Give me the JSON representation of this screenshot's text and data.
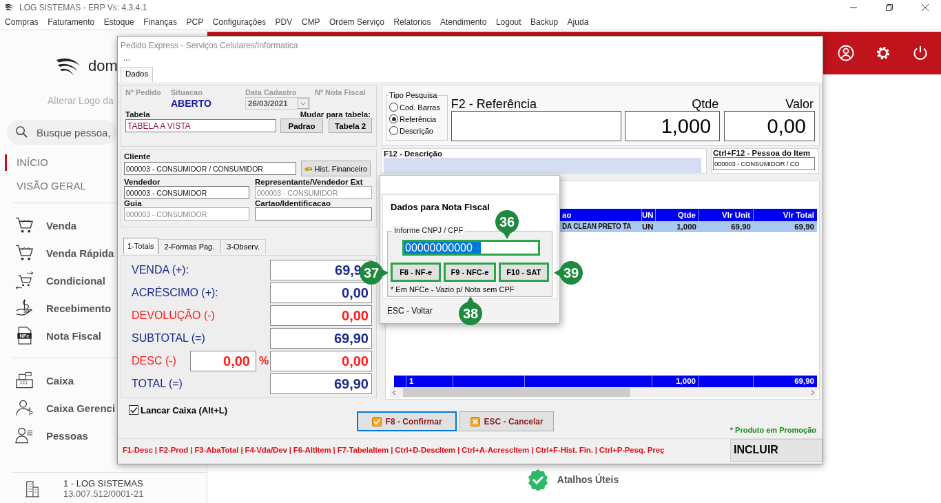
{
  "window": {
    "title": "LOG SISTEMAS - ERP Vs: 4.3.4.1"
  },
  "menu": [
    "Compras",
    "Faturamento",
    "Estoque",
    "Finanças",
    "PCP",
    "Configurações",
    "PDV",
    "CMP",
    "Ordem Serviço",
    "Relatorios",
    "Atendimento",
    "Logout",
    "Backup",
    "Ajuda"
  ],
  "background": {
    "logo_text": "dom",
    "logo_caption": "Alterar Logo da",
    "search": {
      "placeholder": "Busque pessoa,"
    },
    "nav_top": [
      {
        "label": "INÍCIO",
        "selected": true
      },
      {
        "label": "VISÃO GERAL",
        "selected": false
      }
    ],
    "nav_groups": [
      [
        {
          "label": "Venda"
        },
        {
          "label": "Venda Rápida"
        },
        {
          "label": "Condicional"
        },
        {
          "label": "Recebimento"
        },
        {
          "label": "Nota Fiscal",
          "icon_text": "NFe"
        }
      ],
      [
        {
          "label": "Caixa"
        },
        {
          "label": "Caixa Gerenci"
        },
        {
          "label": "Pessoas"
        }
      ]
    ],
    "company": {
      "name": "1 - LOG SISTEMAS",
      "cnpj": "13.007.512/0001-21"
    },
    "shortcuts_link": "Atalhos Úteis"
  },
  "dialog": {
    "title": "Pedido Express - Serviços Celulares/Informatica",
    "menu_hint": "...",
    "tabs": [
      {
        "label": "Dados",
        "selected": true
      }
    ],
    "header": {
      "labels": [
        "Nº Pedido",
        "Situacao",
        "Data Cadastro",
        "Nº Nota Fiscal"
      ],
      "status": "ABERTO",
      "date": "26/03/2021",
      "tabela_label": "Tabela",
      "tabela": "TABELA A VISTA",
      "change_label": "Mudar para tabela:",
      "change_buttons": [
        "Padrao",
        "Tabela 2"
      ]
    },
    "people": {
      "cliente_label": "Cliente",
      "cliente": "000003 - CONSUMIDOR / CONSUMIDOR",
      "hist_button": "Hist. Financeiro",
      "fields": [
        {
          "label": "Vendedor",
          "value": "000003 - CONSUMIDOR",
          "disabled": false
        },
        {
          "label": "Representante/Vendedor Ext",
          "value": "000003 - CONSUMIDOR",
          "disabled": true
        },
        {
          "label": "Guia",
          "value": "000003 - CONSUMIDOR",
          "disabled": true
        },
        {
          "label": "Cartao/Identificacao",
          "disabled": false
        }
      ]
    },
    "totals_tabs": [
      {
        "label": "1-Totais",
        "selected": true
      },
      {
        "label": "2-Formas Pag.",
        "selected": false
      },
      {
        "label": "3-Observ.",
        "selected": false
      }
    ],
    "totals": [
      {
        "label": "VENDA (+):",
        "value": "69,9",
        "color": "#1c2a8a"
      },
      {
        "label": "ACRÉSCIMO (+):",
        "value": "0,00",
        "color": "#1c2a8a"
      },
      {
        "label": "DEVOLUÇÃO (-)",
        "value": "0,00",
        "color": "#ff1a1a"
      },
      {
        "label": "SUBTOTAL (=)",
        "value": "69,90",
        "color": "#1c2a8a"
      },
      {
        "label": "DESC (-)",
        "value": "0,00",
        "color": "#ff1a1a",
        "percent": "0,00",
        "percent_sign": "%"
      },
      {
        "label": "TOTAL  (=)",
        "value": "69,90",
        "color": "#1c2a8a"
      }
    ],
    "lancar_caixa": {
      "label": "Lancar Caixa (Alt+L)",
      "checked": true
    },
    "buttons": [
      {
        "label": "F8 - Confirmar",
        "kind": "confirm",
        "default": true
      },
      {
        "label": "ESC - Cancelar",
        "kind": "cancel",
        "default": false
      }
    ],
    "promo_note": "* Produto em Promoção",
    "shortcut_bar": "F1-Desc | F2-Prod | F3-AbaTotal | F4-Vda/Dev | F6-AltItem | F7-TabelaItem | Ctrl+D-DescItem | Ctrl+A-AcrescItem | Ctrl+F-Hist. Fin. | Ctrl+P-Pesq. Preç",
    "mode": "INCLUIR",
    "search": {
      "tipo_title": "Tipo Pesquisa",
      "options": [
        {
          "label": "Cod. Barras",
          "selected": false
        },
        {
          "label": "Referência",
          "selected": true
        },
        {
          "label": "Descrição",
          "selected": false
        }
      ],
      "referencia_label": "F2 - Referência",
      "qtde_label": "Qtde",
      "qtde": "1,000",
      "valor_label": "Valor",
      "valor": "0,00",
      "descricao_label": "F12 - Descrição",
      "pessoa_item_label": "Ctrl+F12 - Pessoa do Item",
      "pessoa_item": "000003 - CONSUMIDOR / CO"
    },
    "items_table": {
      "columns": [
        "ao",
        "UN",
        "Qtde",
        "Vlr Unit",
        "Vlr Total"
      ],
      "rows": [
        {
          "cells": [
            "DA CLEAN PRETO TA",
            "UN",
            "1,000",
            "69,90",
            "69,90"
          ],
          "selected": true
        }
      ],
      "footer": {
        "count": "1",
        "qtde": "1,000",
        "total": "69,90"
      }
    }
  },
  "popup": {
    "title": "Dados para Nota Fiscal",
    "group_label": "Informe CNPJ / CPF",
    "cnpj": "00000000000",
    "buttons": [
      "F8 - NF-e",
      "F9 - NFC-e",
      "F10 - SAT"
    ],
    "note": "* Em NFCe - Vazio p/ Nota sem CPF",
    "back": "ESC - Voltar"
  },
  "annotations": [
    {
      "number": "36"
    },
    {
      "number": "37"
    },
    {
      "number": "38"
    },
    {
      "number": "39"
    }
  ]
}
